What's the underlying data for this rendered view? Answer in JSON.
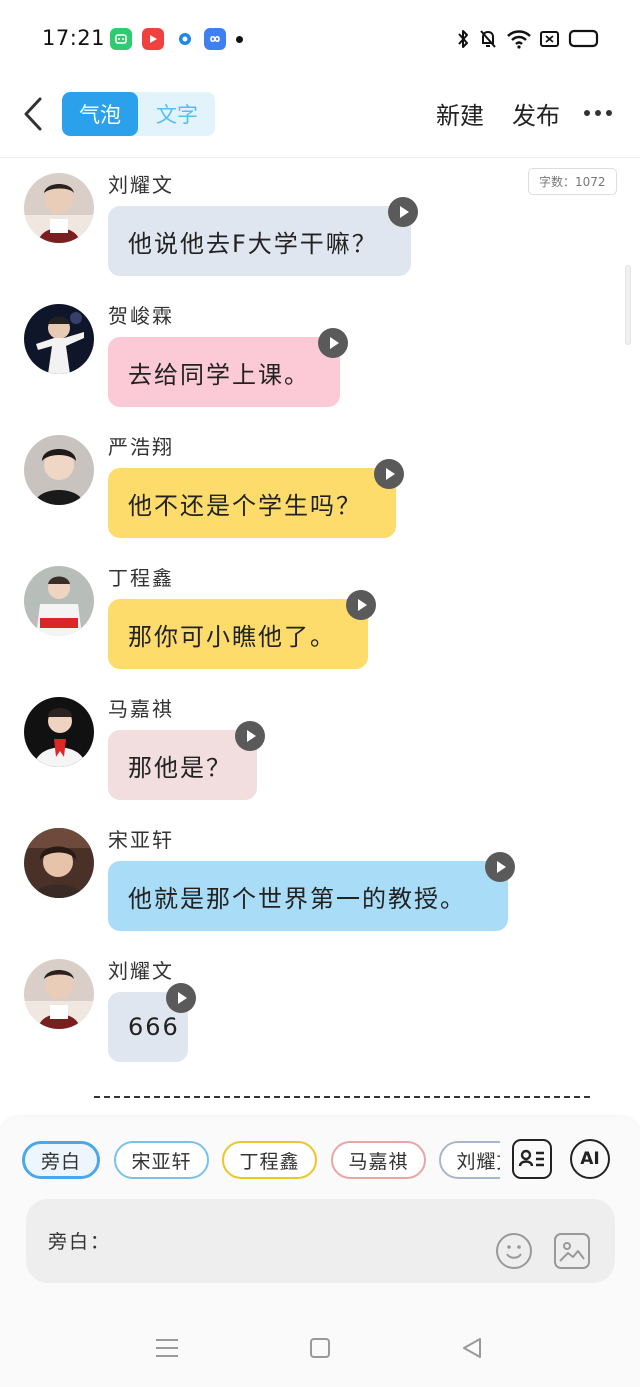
{
  "status_bar": {
    "time": "17:21",
    "app_icons": [
      "app-green-icon",
      "app-red-play-icon",
      "app-blue-circle-icon",
      "app-blue-link-icon"
    ],
    "system_icons": [
      "bluetooth-icon",
      "mute-bell-icon",
      "wifi-icon",
      "sim-icon",
      "battery-icon"
    ]
  },
  "header": {
    "mode_tabs": [
      {
        "label": "气泡",
        "active": true
      },
      {
        "label": "文字",
        "active": false
      }
    ],
    "new_label": "新建",
    "publish_label": "发布"
  },
  "chat": {
    "word_count": "字数：1072",
    "messages": [
      {
        "speaker": "刘耀文",
        "text": "他说他去F大学干嘛？",
        "color": "#e0e6ef"
      },
      {
        "speaker": "贺峻霖",
        "text": "去给同学上课。",
        "color": "#fcc9d6"
      },
      {
        "speaker": "严浩翔",
        "text": "他不还是个学生吗？",
        "color": "#fddc6b"
      },
      {
        "speaker": "丁程鑫",
        "text": "那你可小瞧他了。",
        "color": "#fddc6b"
      },
      {
        "speaker": "马嘉祺",
        "text": "那他是？",
        "color": "#f2dede"
      },
      {
        "speaker": "宋亚轩",
        "text": "他就是那个世界第一的教授。",
        "color": "#a9dcf6"
      },
      {
        "speaker": "刘耀文",
        "text": "666",
        "color": "#e0e6ef"
      }
    ]
  },
  "role_chips": [
    {
      "label": "旁白",
      "border": "#4ba6ea",
      "selected": true
    },
    {
      "label": "宋亚轩",
      "border": "#78c2ec",
      "selected": false
    },
    {
      "label": "丁程鑫",
      "border": "#ecc626",
      "selected": false
    },
    {
      "label": "马嘉祺",
      "border": "#eaa5a5",
      "selected": false
    },
    {
      "label": "刘耀文",
      "border": "#a9b8c9",
      "selected": false
    }
  ],
  "ai_label": "AI",
  "input": {
    "label": "旁白："
  }
}
